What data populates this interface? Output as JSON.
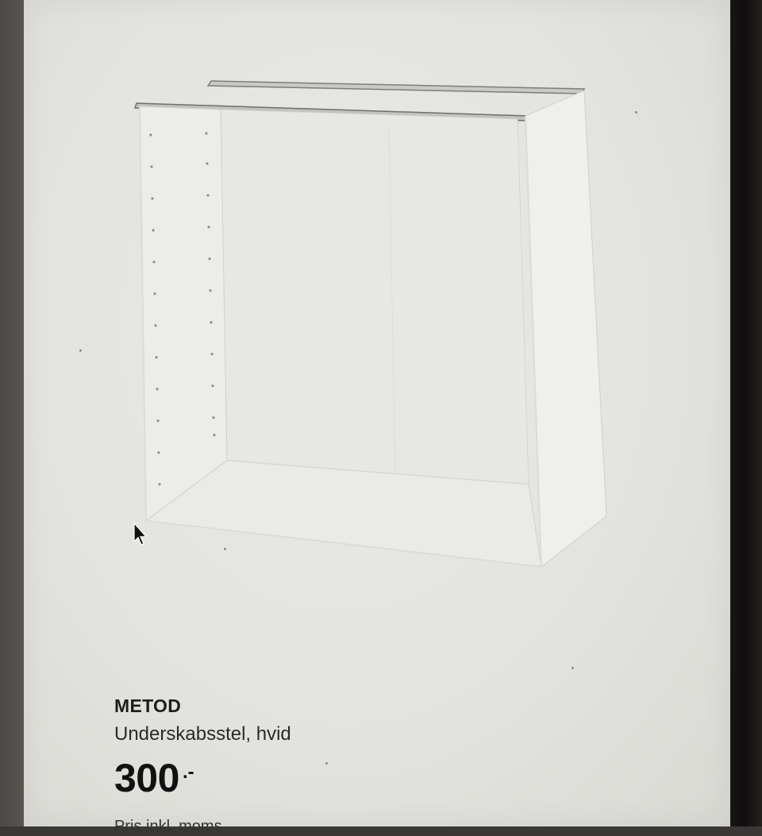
{
  "product": {
    "image_alt": "METOD cabinet frame",
    "name": "METOD",
    "description": "Underskabsstel, hvid",
    "price_value": "300",
    "price_suffix": ".-",
    "price_note": "Pris inkl. moms"
  },
  "colors": {
    "screen_background": "#e6e6e2",
    "cabinet_white": "#f2f2ef",
    "text_primary": "#1d1d1d"
  },
  "icons": {
    "cursor": "mouse-pointer-icon"
  }
}
